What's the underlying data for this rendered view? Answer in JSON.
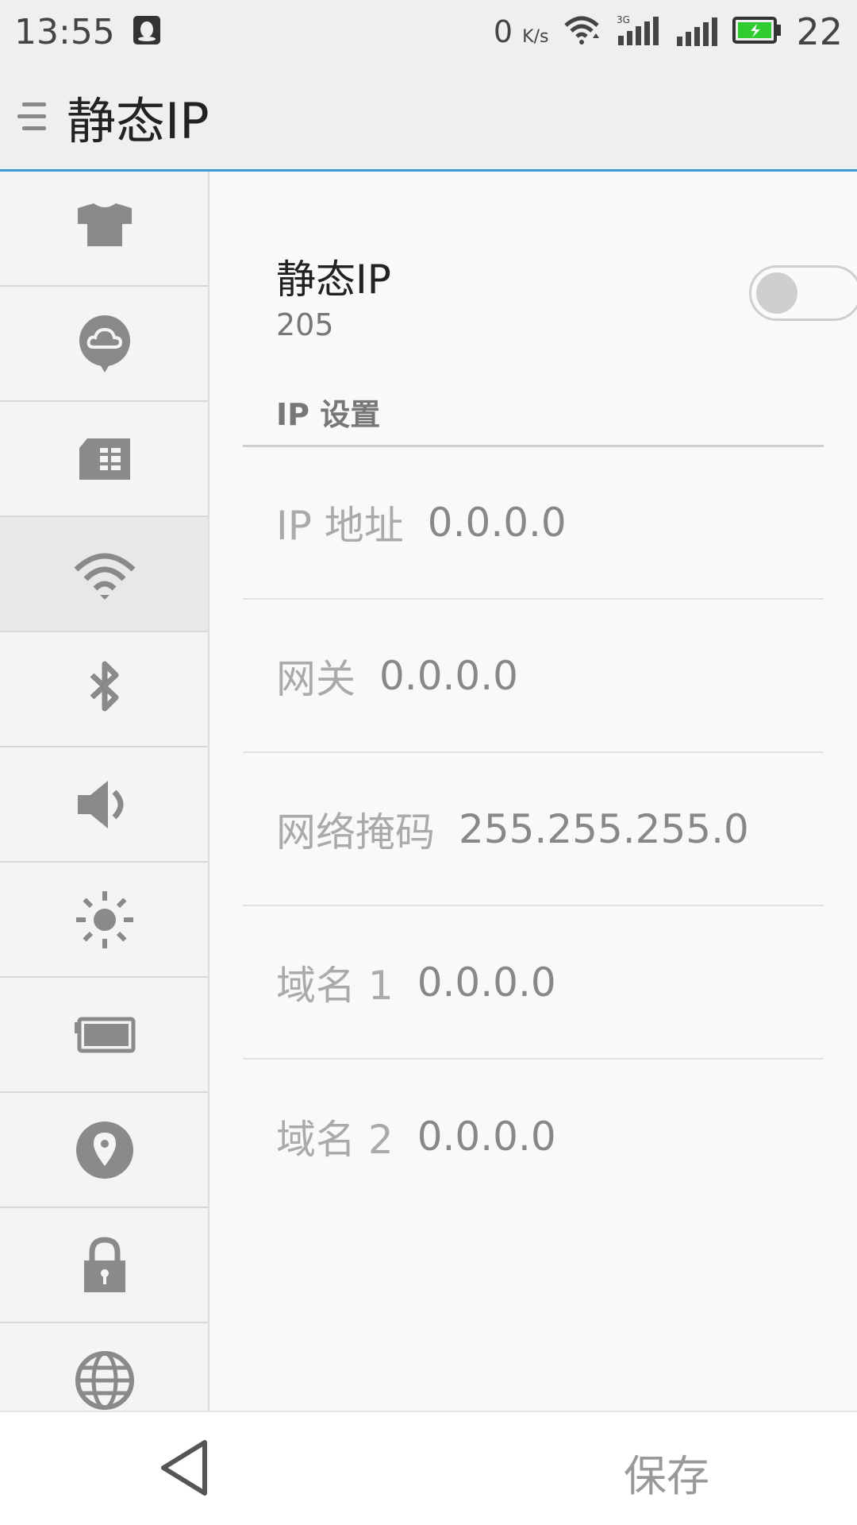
{
  "status_bar": {
    "time": "13:55",
    "net_speed": "0",
    "net_speed_unit": "K/s",
    "network_type": "3G",
    "battery_level": "22",
    "icons": [
      "qq-icon",
      "wifi-icon",
      "signal-3g-icon",
      "signal-icon",
      "battery-charging-icon"
    ]
  },
  "app_bar": {
    "title": "静态IP"
  },
  "sidebar": {
    "items": [
      {
        "icon": "shirt-icon",
        "active": false
      },
      {
        "icon": "cloud-icon",
        "active": false
      },
      {
        "icon": "sim-card-icon",
        "active": false
      },
      {
        "icon": "wifi-icon",
        "active": true
      },
      {
        "icon": "bluetooth-icon",
        "active": false
      },
      {
        "icon": "speaker-icon",
        "active": false
      },
      {
        "icon": "brightness-icon",
        "active": false
      },
      {
        "icon": "battery-icon",
        "active": false
      },
      {
        "icon": "location-icon",
        "active": false
      },
      {
        "icon": "lock-icon",
        "active": false
      },
      {
        "icon": "globe-icon",
        "active": false
      }
    ]
  },
  "static_ip": {
    "title": "静态IP",
    "subtitle": "205",
    "enabled": false
  },
  "ip_settings": {
    "header": "IP 设置",
    "fields": [
      {
        "label": "IP 地址",
        "value": "0.0.0.0"
      },
      {
        "label": "网关",
        "value": "0.0.0.0"
      },
      {
        "label": "网络掩码",
        "value": "255.255.255.0"
      },
      {
        "label": "域名 1",
        "value": "0.0.0.0"
      },
      {
        "label": "域名 2",
        "value": "0.0.0.0"
      }
    ]
  },
  "bottom_bar": {
    "save_label": "保存"
  },
  "colors": {
    "accent": "#3b9bd6",
    "icon_gray": "#8a8a8a",
    "battery_green": "#2ecc2e"
  }
}
